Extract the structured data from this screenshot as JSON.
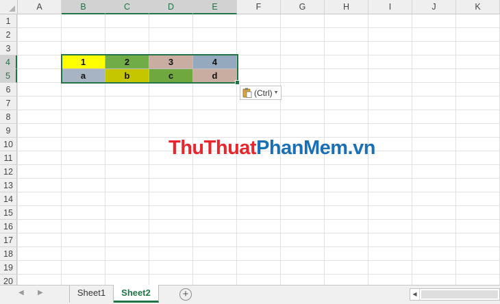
{
  "columns": [
    "A",
    "B",
    "C",
    "D",
    "E",
    "F",
    "G",
    "H",
    "I",
    "J",
    "K"
  ],
  "rows": [
    "1",
    "2",
    "3",
    "4",
    "5",
    "6",
    "7",
    "8",
    "9",
    "10",
    "11",
    "12",
    "13",
    "14",
    "15",
    "16",
    "17",
    "18",
    "19",
    "20"
  ],
  "selected_columns": [
    "B",
    "C",
    "D",
    "E"
  ],
  "selected_rows": [
    "4",
    "5"
  ],
  "cells": [
    {
      "ref": "B4",
      "value": "1",
      "fill": "#ffff00"
    },
    {
      "ref": "C4",
      "value": "2",
      "fill": "#70ad47"
    },
    {
      "ref": "D4",
      "value": "3",
      "fill": "#c9ada1"
    },
    {
      "ref": "E4",
      "value": "4",
      "fill": "#94a9bd"
    },
    {
      "ref": "B5",
      "value": "a",
      "fill": "#a6b4c3"
    },
    {
      "ref": "C5",
      "value": "b",
      "fill": "#c6c600"
    },
    {
      "ref": "D5",
      "value": "c",
      "fill": "#6fa83f"
    },
    {
      "ref": "E5",
      "value": "d",
      "fill": "#c9ada1"
    }
  ],
  "paste_options": {
    "label": "(Ctrl)",
    "icon": "clipboard-icon"
  },
  "watermark": {
    "part1": "ThuThuat",
    "part2": "PhanMem.vn"
  },
  "sheets": [
    {
      "label": "Sheet1",
      "active": false
    },
    {
      "label": "Sheet2",
      "active": true
    }
  ],
  "tabbar": {
    "prev_icon": "◀",
    "next_icon": "▶",
    "add_icon": "+",
    "scroll_left_icon": "◀"
  },
  "colors": {
    "accent": "#217346",
    "header_bg": "#efefef",
    "gridline": "#e1e1e1"
  }
}
